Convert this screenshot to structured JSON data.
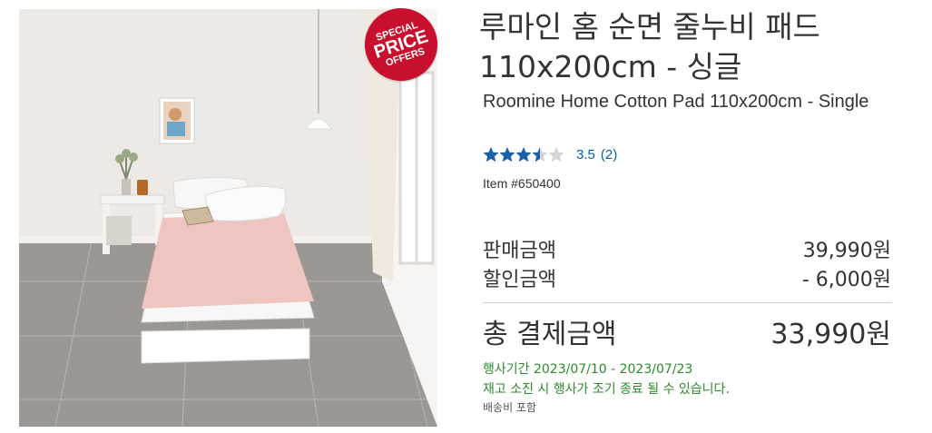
{
  "product": {
    "title_ko": "루마인 홈 순면 줄누비 패드 110x200cm - 싱글",
    "title_en": "Roomine Home Cotton Pad 110x200cm - Single",
    "rating_value": "3.5",
    "rating_stars": 3.5,
    "rating_max": 5,
    "review_count": "(2)",
    "item_number": "Item #650400"
  },
  "badge": {
    "line1": "SPECIAL",
    "line2": "PRICE",
    "line3": "OFFERS"
  },
  "pricing": {
    "sale_label": "판매금액",
    "sale_value": "39,990원",
    "discount_label": "할인금액",
    "discount_value": "- 6,000원",
    "total_label": "총 결제금액",
    "total_value": "33,990원"
  },
  "promo": {
    "period": "행사기간 2023/07/10 - 2023/07/23",
    "notice": "재고 소진 시 행사가 조기 종료 될 수 있습니다."
  },
  "shipping": "배송비 포함",
  "colors": {
    "badge_red": "#c8102e",
    "star_blue": "#1a5fa8",
    "link_blue": "#0060a9",
    "promo_green": "#2d8a2d"
  },
  "icons": {
    "zoom": "magnifier-icon"
  }
}
